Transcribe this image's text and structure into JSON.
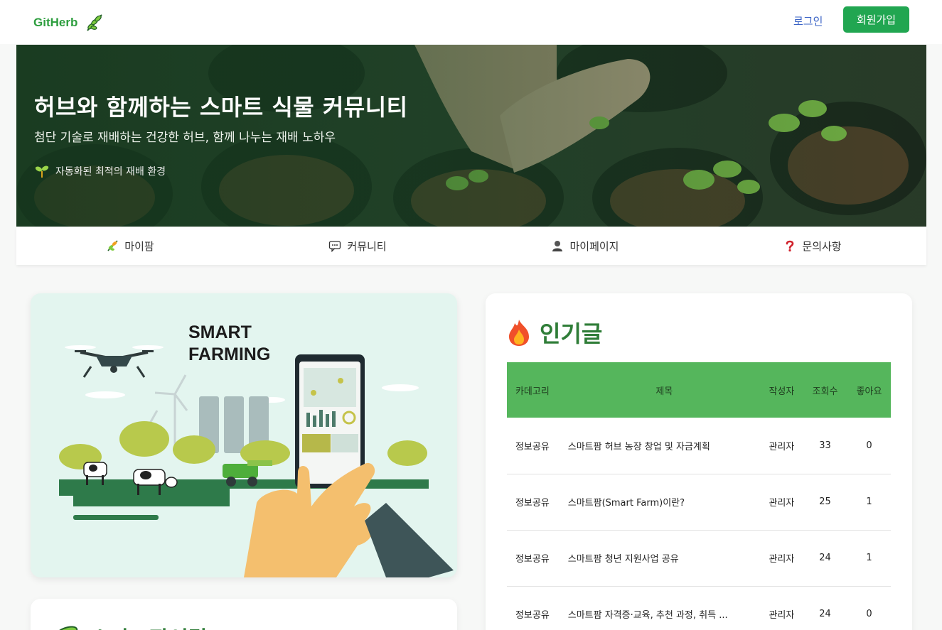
{
  "header": {
    "brand": "GitHerb",
    "login": "로그인",
    "signup": "회원가입"
  },
  "hero": {
    "title": "허브와 함께하는 스마트 식물 커뮤니티",
    "subtitle": "첨단 기술로 재배하는 건강한 허브, 함께 나누는 재배 노하우",
    "feature": "자동화된 최적의 재배 환경"
  },
  "nav": {
    "items": [
      {
        "label": "마이팜",
        "icon": "herb-icon"
      },
      {
        "label": "커뮤니티",
        "icon": "chat-icon"
      },
      {
        "label": "마이페이지",
        "icon": "person-icon"
      },
      {
        "label": "문의사항",
        "icon": "question-icon"
      }
    ]
  },
  "promo": {
    "title_line1": "SMART",
    "title_line2": "FARMING"
  },
  "smart_card": {
    "title": "스마트팜이란?"
  },
  "popular": {
    "title": "인기글",
    "icon": "fire-icon",
    "columns": [
      "카데고리",
      "제목",
      "작성자",
      "조회수",
      "좋아요"
    ],
    "rows": [
      {
        "category": "정보공유",
        "title": "스마트팜 허브 농장 창업 및 자금계획",
        "author": "관리자",
        "views": "33",
        "likes": "0"
      },
      {
        "category": "정보공유",
        "title": "스마트팜(Smart Farm)이란?",
        "author": "관리자",
        "views": "25",
        "likes": "1"
      },
      {
        "category": "정보공유",
        "title": "스마트팜 청년 지원사업 공유",
        "author": "관리자",
        "views": "24",
        "likes": "1"
      },
      {
        "category": "정보공유",
        "title": "스마트팜 자격증·교육, 추천 과정, 취득 ...",
        "author": "관리자",
        "views": "24",
        "likes": "0"
      }
    ]
  },
  "colors": {
    "brand": "#2e9e3f",
    "signup_bg": "#21a651",
    "table_header": "#55b65c",
    "heading_green": "#2f7d38"
  }
}
